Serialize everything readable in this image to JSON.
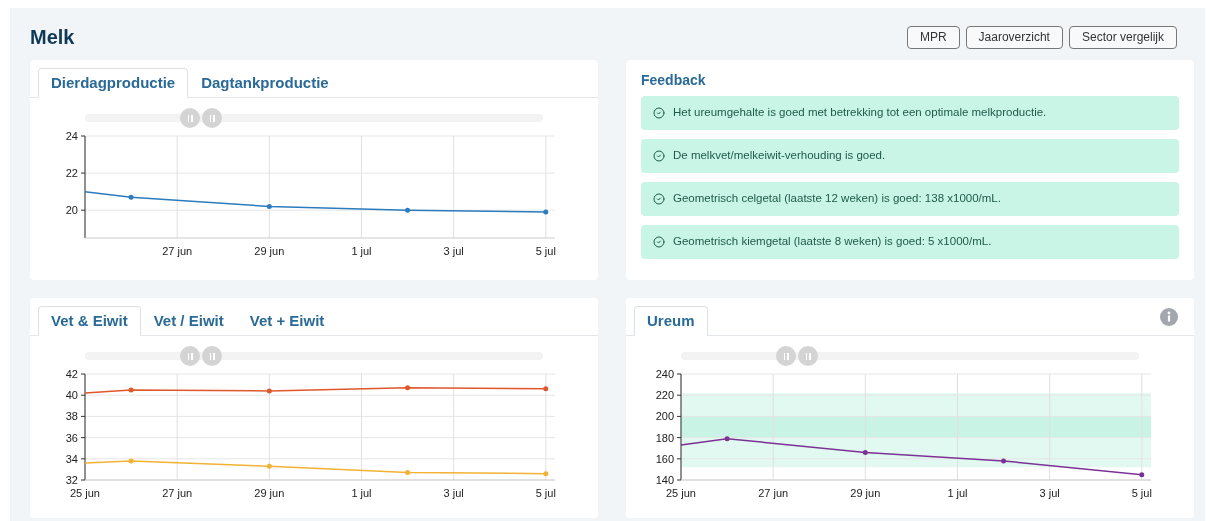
{
  "page": {
    "title": "Melk",
    "buttons": [
      "MPR",
      "Jaaroverzicht",
      "Sector vergelijk"
    ]
  },
  "production_panel": {
    "tabs": [
      {
        "label": "Dierdagproductie",
        "selected": true
      },
      {
        "label": "Dagtankproductie",
        "selected": false
      }
    ],
    "navigator": {
      "level": 0.25
    },
    "chart_data": {
      "type": "line",
      "categories": [
        null,
        null,
        "27 jun",
        null,
        "29 jun",
        null,
        "1 jul",
        null,
        "3 jul",
        null,
        "5 jul"
      ],
      "series": [
        {
          "color": "#2b7bbf",
          "values": [
            21.0,
            20.7,
            null,
            null,
            20.2,
            null,
            null,
            20.0,
            null,
            null,
            19.9
          ]
        }
      ],
      "grid": true,
      "ylim": [
        18.5,
        24
      ],
      "yticks": [
        20,
        22,
        24
      ]
    }
  },
  "feedback": {
    "title": "Feedback",
    "items": [
      {
        "text": "Het ureumgehalte is goed met betrekking tot een optimale melkproductie."
      },
      {
        "text": "De melkvet/melkeiwit-verhouding is goed."
      },
      {
        "text": "Geometrisch celgetal (laatste 12 weken) is goed: 138 x1000/mL."
      },
      {
        "text": "Geometrisch kiemgetal (laatste 8 weken) is goed: 5 x1000/mL."
      }
    ]
  },
  "composition_panel": {
    "tabs": [
      {
        "label": "Vet & Eiwit",
        "selected": true
      },
      {
        "label": "Vet / Eiwit",
        "selected": false
      },
      {
        "label": "Vet + Eiwit",
        "selected": false
      }
    ],
    "navigator": {
      "level": 0.25
    },
    "chart_data": {
      "type": "line",
      "categories": [
        "25 jun",
        null,
        "27 jun",
        null,
        "29 jun",
        null,
        "1 jul",
        null,
        "3 jul",
        null,
        "5 jul"
      ],
      "series": [
        {
          "color": "#e0572a",
          "values": [
            40.2,
            40.5,
            null,
            null,
            40.4,
            null,
            null,
            40.7,
            null,
            null,
            40.6
          ]
        },
        {
          "color": "#f2b233",
          "values": [
            33.6,
            33.8,
            null,
            null,
            33.3,
            null,
            null,
            32.7,
            null,
            null,
            32.6
          ]
        }
      ],
      "grid": true,
      "ylim": [
        32,
        42
      ],
      "yticks": [
        32,
        34,
        36,
        38,
        40,
        42
      ]
    }
  },
  "urea_panel": {
    "tabs": [
      {
        "label": "Ureum",
        "selected": true
      }
    ],
    "navigator": {
      "level": 0.25
    },
    "chart_data": {
      "type": "line",
      "categories": [
        "25 jun",
        null,
        "27 jun",
        null,
        "29 jun",
        null,
        "1 jul",
        null,
        "3 jul",
        null,
        "5 jul"
      ],
      "series": [
        {
          "color": "#7b3294",
          "values": [
            173,
            179,
            null,
            null,
            166,
            null,
            null,
            158,
            null,
            null,
            145
          ]
        }
      ],
      "ylim": [
        140,
        240
      ],
      "yticks": [
        140,
        160,
        180,
        200,
        220,
        240
      ],
      "grid": true,
      "bands": [
        {
          "axis": "y",
          "from": 152,
          "to": 222
        },
        {
          "axis": "y",
          "from": 180,
          "to": 200
        }
      ]
    }
  }
}
